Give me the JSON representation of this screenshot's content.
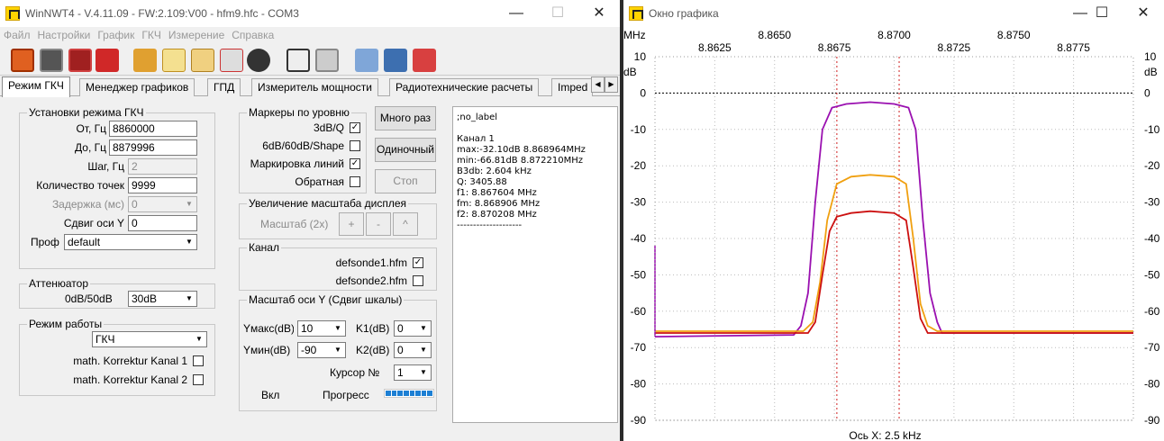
{
  "main": {
    "title": "WinNWT4 - V.4.11.09 - FW:2.109:V00 - hfm9.hfc - COM3",
    "menu": [
      "Файл",
      "Настройки",
      "График",
      "ГКЧ",
      "Измерение",
      "Справка"
    ],
    "tabs": [
      "Режим ГКЧ",
      "Менеджер графиков",
      "ГПД",
      "Измеритель мощности",
      "Радиотехнические расчеты",
      "Imped"
    ],
    "sweep": {
      "group_label": "Установки режима ГКЧ",
      "from_label": "От, Гц",
      "from_value": "8860000",
      "to_label": "До, Гц",
      "to_value": "8879996",
      "step_label": "Шаг, Гц",
      "step_value": "2",
      "points_label": "Количество точек",
      "points_value": "9999",
      "delay_label": "Задержка (мс)",
      "delay_value": "0",
      "yshift_label": "Сдвиг оси Y",
      "yshift_value": "0",
      "profile_label": "Проф",
      "profile_value": "default"
    },
    "attenuator": {
      "group_label": "Аттенюатор",
      "range_label": "0dB/50dB",
      "value": "30dB"
    },
    "mode": {
      "group_label": "Режим работы",
      "value": "ГКЧ",
      "korr1": "math. Korrektur Kanal 1",
      "korr2": "math. Korrektur Kanal 2"
    },
    "markers": {
      "group_label": "Маркеры по уровню",
      "items": [
        {
          "label": "3dB/Q",
          "checked": "✓"
        },
        {
          "label": "6dB/60dB/Shape",
          "checked": ""
        },
        {
          "label": "Маркировка линий",
          "checked": "✓"
        },
        {
          "label": "Обратная",
          "checked": ""
        }
      ]
    },
    "buttons": {
      "multi": "Много раз",
      "single": "Одиночный",
      "stop": "Стоп"
    },
    "zoom": {
      "group_label": "Увеличение масштаба дисплея",
      "scale": "Масштаб (2х)",
      "plus": "+",
      "minus": "-",
      "up": "^"
    },
    "channel": {
      "group_label": "Канал",
      "ch1": "defsonde1.hfm",
      "ch1_checked": "✓",
      "ch2": "defsonde2.hfm",
      "ch2_checked": ""
    },
    "yscale": {
      "group_label": "Масштаб оси Y (Сдвиг шкалы)",
      "ymax_label": "Yмакс(dB)",
      "ymax_value": "10",
      "ymin_label": "Yмин(dB)",
      "ymin_value": "-90",
      "k1_label": "K1(dB)",
      "k1_value": "0",
      "k2_label": "K2(dB)",
      "k2_value": "0",
      "cursor_label": "Курсор №",
      "cursor_value": "1",
      "on_label": "Вкл",
      "progress_label": "Прогресс"
    },
    "output_lines": [
      ";no_label",
      "",
      "Канал 1",
      "max:-32.10dB 8.868964MHz",
      "min:-66.81dB 8.872210MHz",
      "B3db: 2.604 kHz",
      "Q: 3405.88",
      "f1: 8.867604 MHz",
      "fm: 8.868906 MHz",
      "f2: 8.870208 MHz",
      "--------------------"
    ]
  },
  "plot": {
    "title": "Окно графика",
    "x_unit": "MHz",
    "y_unit_left": "dB",
    "y_unit_right": "dB",
    "x_ticks_top": [
      "8.8650",
      "8.8700",
      "8.8750"
    ],
    "x_ticks_bottom": [
      "8.8625",
      "8.8675",
      "8.8725",
      "8.8775"
    ],
    "x_caption": "Ось X: 2.5 kHz"
  },
  "chart_data": {
    "type": "line",
    "xlim": [
      8.86,
      8.88
    ],
    "ylim": [
      -90,
      10
    ],
    "y_ticks": [
      10,
      0,
      -10,
      -20,
      -30,
      -40,
      -50,
      -60,
      -70,
      -80,
      -90
    ],
    "x_ticks": [
      8.8625,
      8.865,
      8.8675,
      8.87,
      8.8725,
      8.875,
      8.8775
    ],
    "markers_x": [
      8.867604,
      8.870208
    ],
    "reference_line_y": 0,
    "grid": true,
    "colors": {
      "ch1": "#cc1010",
      "ch2": "#f0a010",
      "ch3": "#9a10b0",
      "marker": "#d02020"
    },
    "series": [
      {
        "color": "#9a10b0",
        "x": [
          8.86,
          8.8658,
          8.8661,
          8.8664,
          8.8667,
          8.867,
          8.8674,
          8.868,
          8.869,
          8.87,
          8.8706,
          8.8709,
          8.8712,
          8.8715,
          8.8718,
          8.872,
          8.876,
          8.88
        ],
        "y": [
          -67,
          -66.5,
          -64,
          -55,
          -30,
          -10,
          -4,
          -3,
          -2.5,
          -3,
          -4,
          -10,
          -35,
          -55,
          -63,
          -66,
          -66,
          -66
        ]
      },
      {
        "color": "#f0a010",
        "x": [
          8.86,
          8.8662,
          8.8666,
          8.8669,
          8.8672,
          8.8676,
          8.8682,
          8.869,
          8.87,
          8.8705,
          8.8708,
          8.8711,
          8.8714,
          8.8718,
          8.876,
          8.88
        ],
        "y": [
          -65.5,
          -65.5,
          -63,
          -52,
          -35,
          -25,
          -23,
          -22.5,
          -23,
          -25,
          -40,
          -58,
          -64,
          -65.5,
          -65.5,
          -65.5
        ]
      },
      {
        "color": "#cc1010",
        "x": [
          8.86,
          8.8664,
          8.8667,
          8.867,
          8.8673,
          8.8676,
          8.8682,
          8.869,
          8.87,
          8.8705,
          8.8708,
          8.8711,
          8.8714,
          8.876,
          8.88
        ],
        "y": [
          -66,
          -66,
          -63,
          -50,
          -38,
          -34,
          -33,
          -32.5,
          -33,
          -35,
          -48,
          -62,
          -66,
          -66,
          -66
        ]
      }
    ]
  }
}
